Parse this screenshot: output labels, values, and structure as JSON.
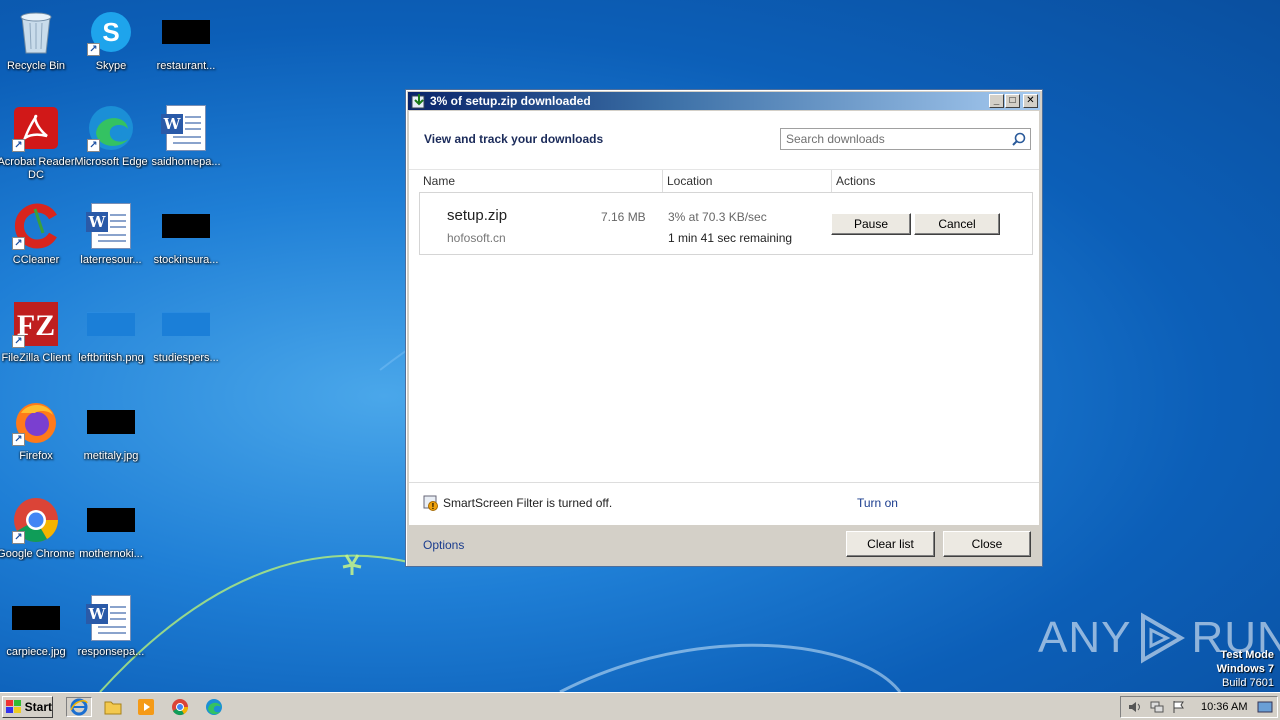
{
  "desktop_icons": [
    {
      "id": "recycle-bin",
      "label": "Recycle Bin"
    },
    {
      "id": "skype",
      "label": "Skype"
    },
    {
      "id": "restaurant",
      "label": "restaurant..."
    },
    {
      "id": "acrobat",
      "label": "Acrobat Reader DC"
    },
    {
      "id": "edge",
      "label": "Microsoft Edge"
    },
    {
      "id": "saidhomepa",
      "label": "saidhomepa..."
    },
    {
      "id": "ccleaner",
      "label": "CCleaner"
    },
    {
      "id": "laterresour",
      "label": "laterresour..."
    },
    {
      "id": "stockinsura",
      "label": "stockinsura..."
    },
    {
      "id": "filezilla",
      "label": "FileZilla Client"
    },
    {
      "id": "leftbritish",
      "label": "leftbritish.png"
    },
    {
      "id": "studiespers",
      "label": "studiespers..."
    },
    {
      "id": "firefox",
      "label": "Firefox"
    },
    {
      "id": "metitaly",
      "label": "metitaly.jpg"
    },
    {
      "id": "chrome",
      "label": "Google Chrome"
    },
    {
      "id": "mothernoki",
      "label": "mothernoki..."
    },
    {
      "id": "carpiece",
      "label": "carpiece.jpg"
    },
    {
      "id": "responsepa",
      "label": "responsepa..."
    }
  ],
  "dialog": {
    "title": "3% of setup.zip downloaded",
    "heading": "View and track your downloads",
    "search_placeholder": "Search downloads",
    "columns": {
      "name": "Name",
      "location": "Location",
      "actions": "Actions"
    },
    "item": {
      "filename": "setup.zip",
      "size": "7.16 MB",
      "domain": "hofosoft.cn",
      "status": "3% at 70.3 KB/sec",
      "remaining": "1 min 41 sec remaining",
      "pause_label": "Pause",
      "cancel_label": "Cancel"
    },
    "smartscreen_message": "SmartScreen Filter is turned off.",
    "turn_on_label": "Turn on",
    "options_label": "Options",
    "clear_list_label": "Clear list",
    "close_label": "Close"
  },
  "watermark": {
    "left": "ANY",
    "right": "RUN"
  },
  "testmode": {
    "line1": "Test Mode",
    "line2": "Windows 7",
    "line3": "Build 7601"
  },
  "taskbar": {
    "start_label": "Start",
    "clock": "10:36 AM"
  },
  "colors": {
    "accent_link": "#1a3c8e",
    "title_gradient_start": "#0a246a"
  }
}
